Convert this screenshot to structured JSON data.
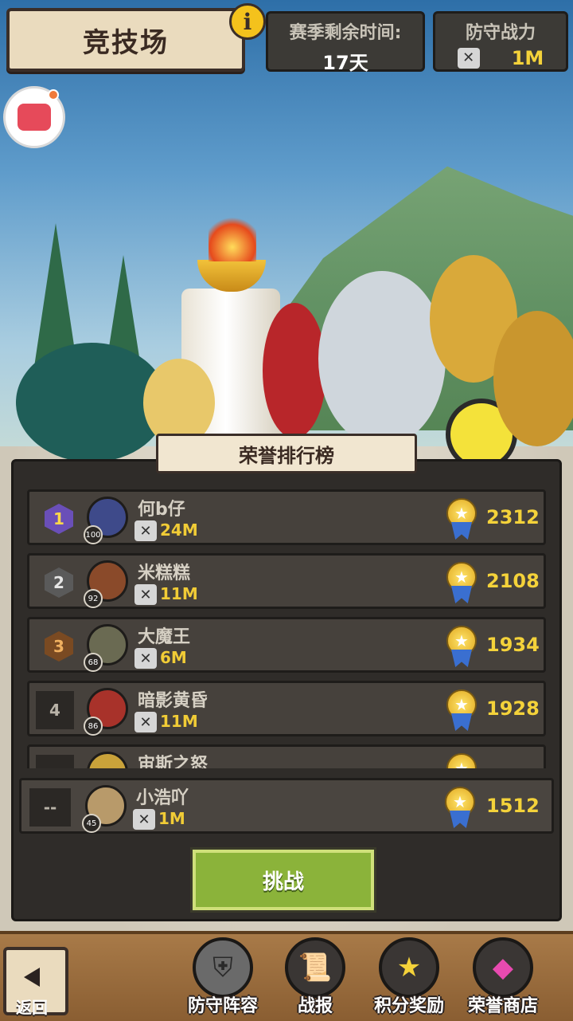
{
  "header": {
    "title": "竞技场",
    "info_icon": "i",
    "season": {
      "label": "赛季剩余时间:",
      "value": "17天"
    },
    "defense": {
      "label": "防守战力",
      "value": "1M"
    }
  },
  "leaderboard": {
    "title": "荣誉排行榜",
    "rows": [
      {
        "rank": "1",
        "name": "何b仔",
        "level": "100",
        "power": "24M",
        "score": "2312",
        "color": "#6a4fb8"
      },
      {
        "rank": "2",
        "name": "米糕糕",
        "level": "92",
        "power": "11M",
        "score": "2108",
        "color": "#7a7a7a"
      },
      {
        "rank": "3",
        "name": "大魔王",
        "level": "68",
        "power": "6M",
        "score": "1934",
        "color": "#b2743a"
      },
      {
        "rank": "4",
        "name": "暗影黄昏",
        "level": "86",
        "power": "11M",
        "score": "1928"
      },
      {
        "name": "宙斯之怒"
      }
    ],
    "me": {
      "rank": "--",
      "name": "小浩吖",
      "level": "45",
      "power": "1M",
      "score": "1512"
    },
    "challenge_label": "挑战"
  },
  "bottom_nav": {
    "back_label": "返回",
    "items": [
      {
        "label": "防守阵容",
        "icon": "shield-swords-icon"
      },
      {
        "label": "战报",
        "icon": "scroll-icon"
      },
      {
        "label": "积分奖励",
        "icon": "medal-icon"
      },
      {
        "label": "荣誉商店",
        "icon": "gems-icon"
      }
    ]
  },
  "colors": {
    "accent_gold": "#f4d23a",
    "button_green": "#8bb33a",
    "panel": "#2f2c29"
  }
}
